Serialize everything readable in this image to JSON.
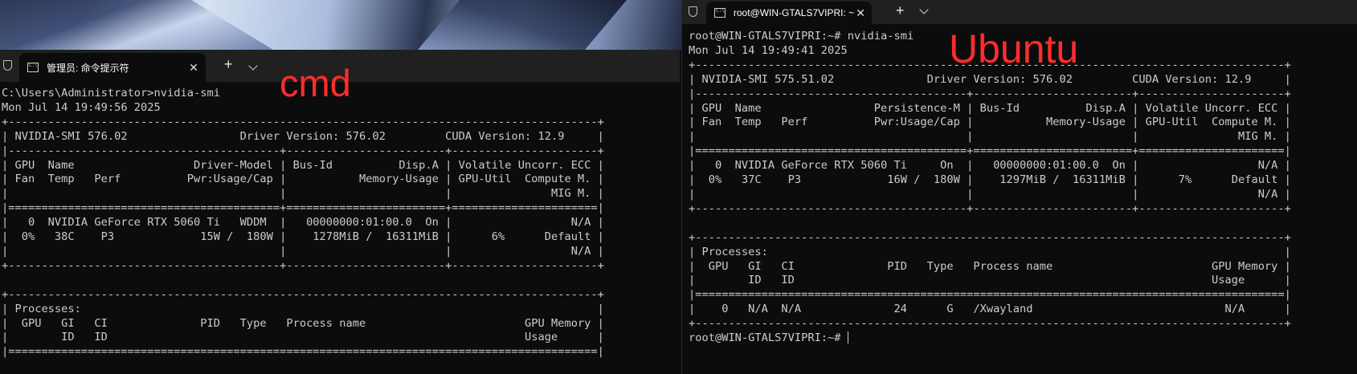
{
  "left": {
    "tab_title": "管理员: 命令提示符",
    "app_icon_text": "C:\\",
    "close_glyph": "✕",
    "newtab_glyph": "+",
    "lines": [
      "C:\\Users\\Administrator>nvidia-smi",
      "Mon Jul 14 19:49:56 2025",
      "+-----------------------------------------------------------------------------------------+",
      "| NVIDIA-SMI 576.02                 Driver Version: 576.02         CUDA Version: 12.9     |",
      "|-----------------------------------------+------------------------+----------------------+",
      "| GPU  Name                  Driver-Model | Bus-Id          Disp.A | Volatile Uncorr. ECC |",
      "| Fan  Temp   Perf          Pwr:Usage/Cap |           Memory-Usage | GPU-Util  Compute M. |",
      "|                                         |                        |               MIG M. |",
      "|=========================================+========================+======================|",
      "|   0  NVIDIA GeForce RTX 5060 Ti   WDDM  |   00000000:01:00.0  On |                  N/A |",
      "|  0%   38C    P3             15W /  180W |    1278MiB /  16311MiB |      6%      Default |",
      "|                                         |                        |                  N/A |",
      "+-----------------------------------------+------------------------+----------------------+",
      "",
      "+-----------------------------------------------------------------------------------------+",
      "| Processes:                                                                              |",
      "|  GPU   GI   CI              PID   Type   Process name                        GPU Memory |",
      "|        ID   ID                                                               Usage      |",
      "|=========================================================================================|"
    ],
    "overlay_label": "cmd"
  },
  "right": {
    "tab_title": "root@WIN-GTALS7VIPRI: ~",
    "app_icon_text": "C:\\",
    "close_glyph": "✕",
    "newtab_glyph": "+",
    "lines": [
      "root@WIN-GTALS7VIPRI:~# nvidia-smi",
      "Mon Jul 14 19:49:41 2025",
      "+-----------------------------------------------------------------------------------------+",
      "| NVIDIA-SMI 575.51.02              Driver Version: 576.02         CUDA Version: 12.9     |",
      "|-----------------------------------------+------------------------+----------------------+",
      "| GPU  Name                 Persistence-M | Bus-Id          Disp.A | Volatile Uncorr. ECC |",
      "| Fan  Temp   Perf          Pwr:Usage/Cap |           Memory-Usage | GPU-Util  Compute M. |",
      "|                                         |                        |               MIG M. |",
      "|=========================================+========================+======================|",
      "|   0  NVIDIA GeForce RTX 5060 Ti     On  |   00000000:01:00.0  On |                  N/A |",
      "|  0%   37C    P3             16W /  180W |    1297MiB /  16311MiB |      7%      Default |",
      "|                                         |                        |                  N/A |",
      "+-----------------------------------------+------------------------+----------------------+",
      "",
      "+-----------------------------------------------------------------------------------------+",
      "| Processes:                                                                              |",
      "|  GPU   GI   CI              PID   Type   Process name                        GPU Memory |",
      "|        ID   ID                                                               Usage      |",
      "|=========================================================================================|",
      "|    0   N/A  N/A              24      G   /Xwayland                             N/A      |",
      "+-----------------------------------------------------------------------------------------+"
    ],
    "prompt": "root@WIN-GTALS7VIPRI:~# ",
    "overlay_label": "Ubuntu"
  },
  "colors": {
    "terminal_bg": "#0c0c0c",
    "terminal_text": "#cccccc",
    "tabbar_bg": "#202020",
    "annotation_red": "#ff2d2d"
  }
}
